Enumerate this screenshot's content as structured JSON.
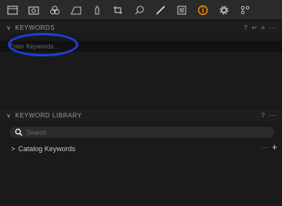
{
  "toolbar": {
    "icons": [
      "library-icon",
      "capture-icon",
      "adjustments-icon",
      "metadata-icon",
      "exposure-icon",
      "crop-icon",
      "lasso-icon",
      "brush-icon",
      "layers-icon",
      "info-icon",
      "settings-icon",
      "hierarchy-icon"
    ],
    "active_index": 9,
    "accent": "#ff8c00"
  },
  "keywords": {
    "title": "KEYWORDS",
    "input_placeholder": "Enter Keywords...",
    "actions": [
      "?",
      "↩",
      "≡",
      "⋯"
    ]
  },
  "library": {
    "title": "KEYWORD LIBRARY",
    "actions": [
      "?",
      "⋯"
    ],
    "search_placeholder": "Search",
    "items": [
      {
        "label": "Catalog Keywords",
        "more": "···",
        "add": "+"
      }
    ]
  },
  "annotation_color": "#1e3fd8"
}
